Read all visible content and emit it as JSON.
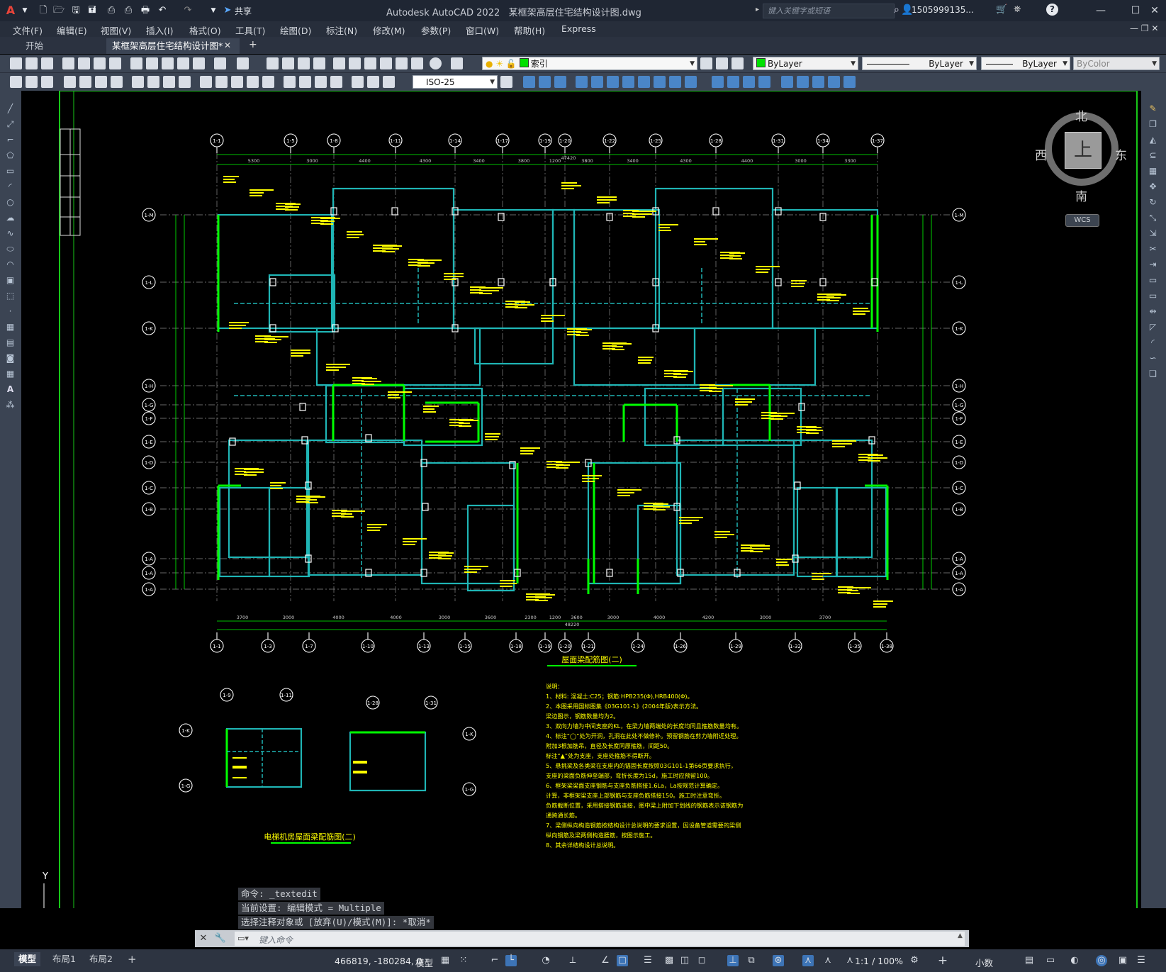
{
  "app": {
    "title": "Autodesk AutoCAD 2022",
    "document": "某框架高层住宅结构设计图.dwg",
    "share": "共享",
    "search_placeholder": "键入关键字或短语",
    "user": "1505999135...",
    "icons": [
      "app-logo-icon",
      "new-icon",
      "open-icon",
      "save-icon",
      "saveas-icon",
      "plot-icon",
      "undo-icon",
      "redo-icon",
      "share-icon"
    ]
  },
  "menus": [
    "文件(F)",
    "编辑(E)",
    "视图(V)",
    "插入(I)",
    "格式(O)",
    "工具(T)",
    "绘图(D)",
    "标注(N)",
    "修改(M)",
    "参数(P)",
    "窗口(W)",
    "帮助(H)",
    "Express"
  ],
  "tabs": [
    {
      "label": "开始"
    },
    {
      "label": "某框架高层住宅结构设计图*"
    }
  ],
  "toolbars": {
    "layer_value": "索引",
    "color_value": "ByLayer",
    "linetype_value": "ByLayer",
    "lineweight_value": "ByLayer",
    "plotstyle_value": "ByColor",
    "dimstyle_value": "ISO-25"
  },
  "viewcube": {
    "north": "北",
    "south": "南",
    "east": "东",
    "west": "西",
    "top": "上",
    "wcs": "WCS"
  },
  "drawing": {
    "main_title": "屋面梁配筋图(二)",
    "small_title": "电梯机房屋面梁配筋图(二)",
    "top_axes": [
      "1-1",
      "1-5",
      "1-8",
      "1-11",
      "1-14",
      "1-17",
      "1-19",
      "1-20",
      "1-22",
      "1-25",
      "1-28",
      "1-31",
      "1-34",
      "1-37"
    ],
    "bottom_axes": [
      "1-1",
      "1-3",
      "1-7",
      "1-10",
      "1-13",
      "1-15",
      "1-18",
      "1-19",
      "1-20",
      "1-21",
      "1-24",
      "1-26",
      "1-29",
      "1-32",
      "1-35",
      "1-38"
    ],
    "left_axes": [
      "1-M",
      "1-L",
      "1-K",
      "1-H",
      "1-G",
      "1-F",
      "1-E",
      "1-D",
      "1-C",
      "1-B",
      "1-A",
      "1-A",
      "1-A"
    ],
    "top_dims": [
      "5300",
      "3000",
      "4400",
      "4300",
      "3400",
      "3800",
      "1200",
      "3800",
      "3400",
      "4300",
      "4400",
      "3000",
      "3300"
    ],
    "overall_top": "47420",
    "overall_bottom": "48220",
    "bottom_dims": [
      "3700",
      "3000",
      "4000",
      "4000",
      "3000",
      "3600",
      "2300",
      "1200",
      "3600",
      "3000",
      "4000",
      "4200",
      "3000",
      "3700"
    ],
    "notes_header": "说明：",
    "notes": [
      "1、材料: 混凝土:C25；钢筋:HPB235(Φ),HRB400(Φ)。",
      "2、本图采用国标图集《03G101-1》(2004年版)表示方法。",
      "   梁边图示，钢筋数量均为2。",
      "3、双向力墙为中间支座的KL，在梁力墙两端处的长度均同且箍筋数量均有。",
      "4、标注“◯”处为开洞，孔洞在此处不做修补。预留钢筋在剪力墙附近处理。",
      "   附加3根加筋吊，直径及长度同原箍筋，间距50。",
      "   标注“▲”处为支座，支座处箍筋不得断开。",
      "5、悬挑梁及各类梁在支座内的锚固长度按照03G101-1第66页要求执行，",
      "   支座的梁面负筋伸至端部，弯折长度为15d，施工时应预留100。",
      "6、框架梁梁面支座钢筋与支座负筋搭接1.6La，La按规范计算确定。",
      "   计算，非框架梁支座上部钢筋与支座负筋搭接150。施工时注意弯折。",
      "   负筋截断位置，采用搭接钢筋连接，图中梁上附加下划线的钢筋表示该钢筋为",
      "   通跨通长筋。",
      "7、梁侧纵向构造钢筋按结构设计总说明的要求设置，因设备管道需要的梁侧",
      "   纵向钢筋及梁两侧构造腰筋，按图示施工。",
      "8、其余详结构设计总说明。"
    ]
  },
  "command": {
    "history": [
      "命令: _textedit",
      "当前设置: 编辑模式 = Multiple",
      "选择注释对象或 [放弃(U)/模式(M)]: *取消*"
    ],
    "placeholder": "键入命令"
  },
  "status": {
    "layout_tabs": [
      "模型",
      "布局1",
      "布局2"
    ],
    "coords": "466819, -180284, 0",
    "mode": "模型",
    "scale": "1:1 / 100%",
    "units": "小数"
  }
}
